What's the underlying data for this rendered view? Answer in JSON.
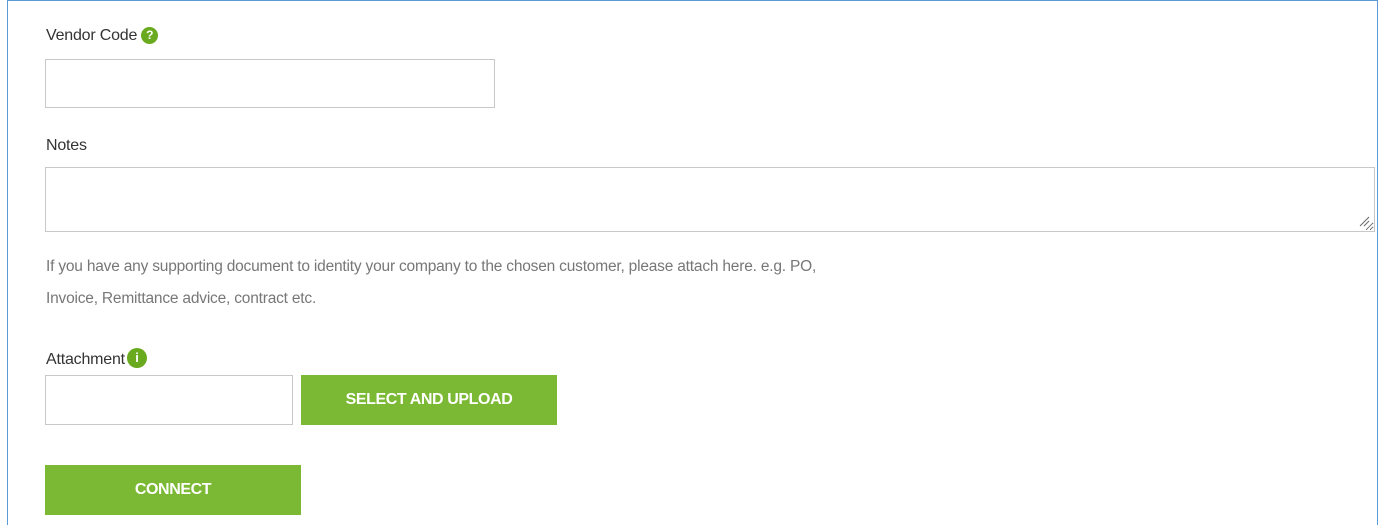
{
  "form": {
    "vendor_code": {
      "label": "Vendor Code",
      "help_icon_glyph": "?",
      "value": "",
      "placeholder": ""
    },
    "notes": {
      "label": "Notes",
      "value": "",
      "placeholder": ""
    },
    "helper_text": {
      "line1": "If you have any supporting document to identity your company to the chosen customer, please attach here. e.g. PO,",
      "line2": "Invoice, Remittance advice, contract etc."
    },
    "attachment": {
      "label": "Attachment",
      "info_icon_glyph": "i",
      "value": "",
      "placeholder": "",
      "upload_button_label": "SELECT AND UPLOAD"
    },
    "connect_button_label": "CONNECT"
  },
  "icons": {
    "vendor_code_help": "question-mark-circle-icon",
    "attachment_info": "info-circle-icon",
    "notes_resize": "resize-grip-icon"
  },
  "colors": {
    "accent_green": "#7bb934",
    "icon_green": "#6aaa1e",
    "frame_blue": "#5b9bd5",
    "input_border": "#c8c8c8",
    "helper_text": "#777777"
  }
}
